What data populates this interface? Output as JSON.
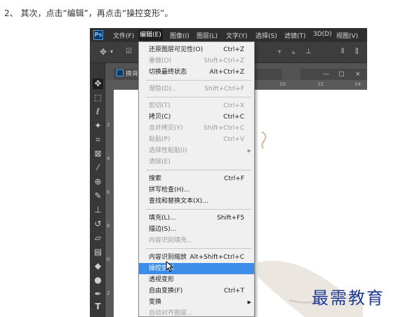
{
  "instruction": "2、 其次，点击“编辑”，再点击“操控变形”。",
  "app": {
    "logo": "Ps",
    "menubar": [
      "文件(F)",
      "编辑(E)",
      "图像(I)",
      "图层(L)",
      "文字(Y)",
      "选择(S)",
      "滤镜(T)",
      "3D(D)",
      "视图(V)"
    ],
    "active_menu_index": 1,
    "document_tab": "换背",
    "doc_controls": [
      "—",
      "□",
      "×"
    ],
    "hruler_ticks": [
      "10",
      "12",
      "14"
    ],
    "vruler_ticks": [
      "2",
      "4",
      "6",
      "8",
      "0",
      "2",
      "4"
    ]
  },
  "edit_menu": {
    "items": [
      {
        "label": "还原图层可见性(O)",
        "shortcut": "Ctrl+Z",
        "state": "enabled"
      },
      {
        "label": "重做(O)",
        "shortcut": "Shift+Ctrl+Z",
        "state": "disabled"
      },
      {
        "label": "切换最终状态",
        "shortcut": "Alt+Ctrl+Z",
        "state": "enabled"
      },
      {
        "label": "渐隐(D)...",
        "shortcut": "Shift+Ctrl+F",
        "state": "disabled"
      },
      {
        "label": "剪切(T)",
        "shortcut": "Ctrl+X",
        "state": "disabled"
      },
      {
        "label": "拷贝(C)",
        "shortcut": "Ctrl+C",
        "state": "enabled"
      },
      {
        "label": "合并拷贝(Y)",
        "shortcut": "Shift+Ctrl+C",
        "state": "disabled"
      },
      {
        "label": "粘贴(P)",
        "shortcut": "Ctrl+V",
        "state": "disabled"
      },
      {
        "label": "选择性粘贴(I)",
        "shortcut": "",
        "state": "disabled",
        "submenu": true
      },
      {
        "label": "清除(E)",
        "shortcut": "",
        "state": "disabled"
      },
      {
        "label": "搜索",
        "shortcut": "Ctrl+F",
        "state": "enabled"
      },
      {
        "label": "拼写检查(H)...",
        "shortcut": "",
        "state": "enabled"
      },
      {
        "label": "查找和替换文本(X)...",
        "shortcut": "",
        "state": "enabled"
      },
      {
        "label": "填充(L)...",
        "shortcut": "Shift+F5",
        "state": "enabled"
      },
      {
        "label": "描边(S)...",
        "shortcut": "",
        "state": "enabled"
      },
      {
        "label": "内容识别填充...",
        "shortcut": "",
        "state": "disabled"
      },
      {
        "label": "内容识别缩放",
        "shortcut": "Alt+Shift+Ctrl+C",
        "state": "enabled"
      },
      {
        "label": "操控变形",
        "shortcut": "",
        "state": "highlighted"
      },
      {
        "label": "透视变形",
        "shortcut": "",
        "state": "enabled"
      },
      {
        "label": "自由变换(F)",
        "shortcut": "Ctrl+T",
        "state": "enabled"
      },
      {
        "label": "变换",
        "shortcut": "",
        "state": "enabled",
        "submenu": true
      },
      {
        "label": "自动对齐图层...",
        "shortcut": "",
        "state": "disabled"
      }
    ]
  },
  "watermark": "最需教育",
  "colors": {
    "highlight": "#3c8ee8",
    "menu_bg": "#f0f0f0",
    "ps_dark": "#2f2f2f",
    "watermark": "#1f3a95"
  }
}
